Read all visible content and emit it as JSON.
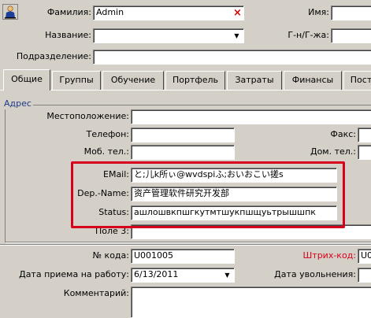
{
  "header": {
    "person_icon": "person-icon",
    "surname_label": "Фамилия:",
    "surname_value": "Admin",
    "name_label": "Имя:",
    "title_label": "Название:",
    "title_value": "",
    "gn_label": "Г-н/Г-жа:",
    "department_label": "Подразделение:",
    "department_value": ""
  },
  "tabs": [
    {
      "label": "Общие"
    },
    {
      "label": "Группы"
    },
    {
      "label": "Обучение"
    },
    {
      "label": "Портфель"
    },
    {
      "label": "Затраты"
    },
    {
      "label": "Финансы"
    },
    {
      "label": "Пост"
    }
  ],
  "address": {
    "group_label": "Адрес",
    "location_label": "Местоположение:",
    "location_value": "",
    "phone_label": "Телефон:",
    "phone_value": "",
    "fax_label": "Факс:",
    "mobile_label": "Моб. тел.:",
    "mobile_value": "",
    "home_phone_label": "Дом. тел.:",
    "email_label": "EMail:",
    "email_value": "と;儿k所ぃ@wvdspiふ;おいおこい搓s",
    "depname_label": "Dep.-Name:",
    "depname_value": "资产管理软件研究开发部",
    "status_label": "Status:",
    "status_value": "ашлошвкпшгкутмтшукпшщуьтрышшпк",
    "field3_label": "Поле 3:"
  },
  "details": {
    "code_label": "№ кода:",
    "code_value": "U001005",
    "barcode_label": "Штрих-код:",
    "barcode_value": "U0",
    "hire_date_label": "Дата приема на работу:",
    "hire_date_value": "6/13/2011",
    "dismissal_label": "Дата увольнения:",
    "comment_label": "Комментарий:"
  },
  "colors": {
    "window_bg": "#d4d0c8",
    "highlight_border": "#d6001c",
    "barcode_label": "#d6001c",
    "group_title": "#1a3a8a"
  }
}
